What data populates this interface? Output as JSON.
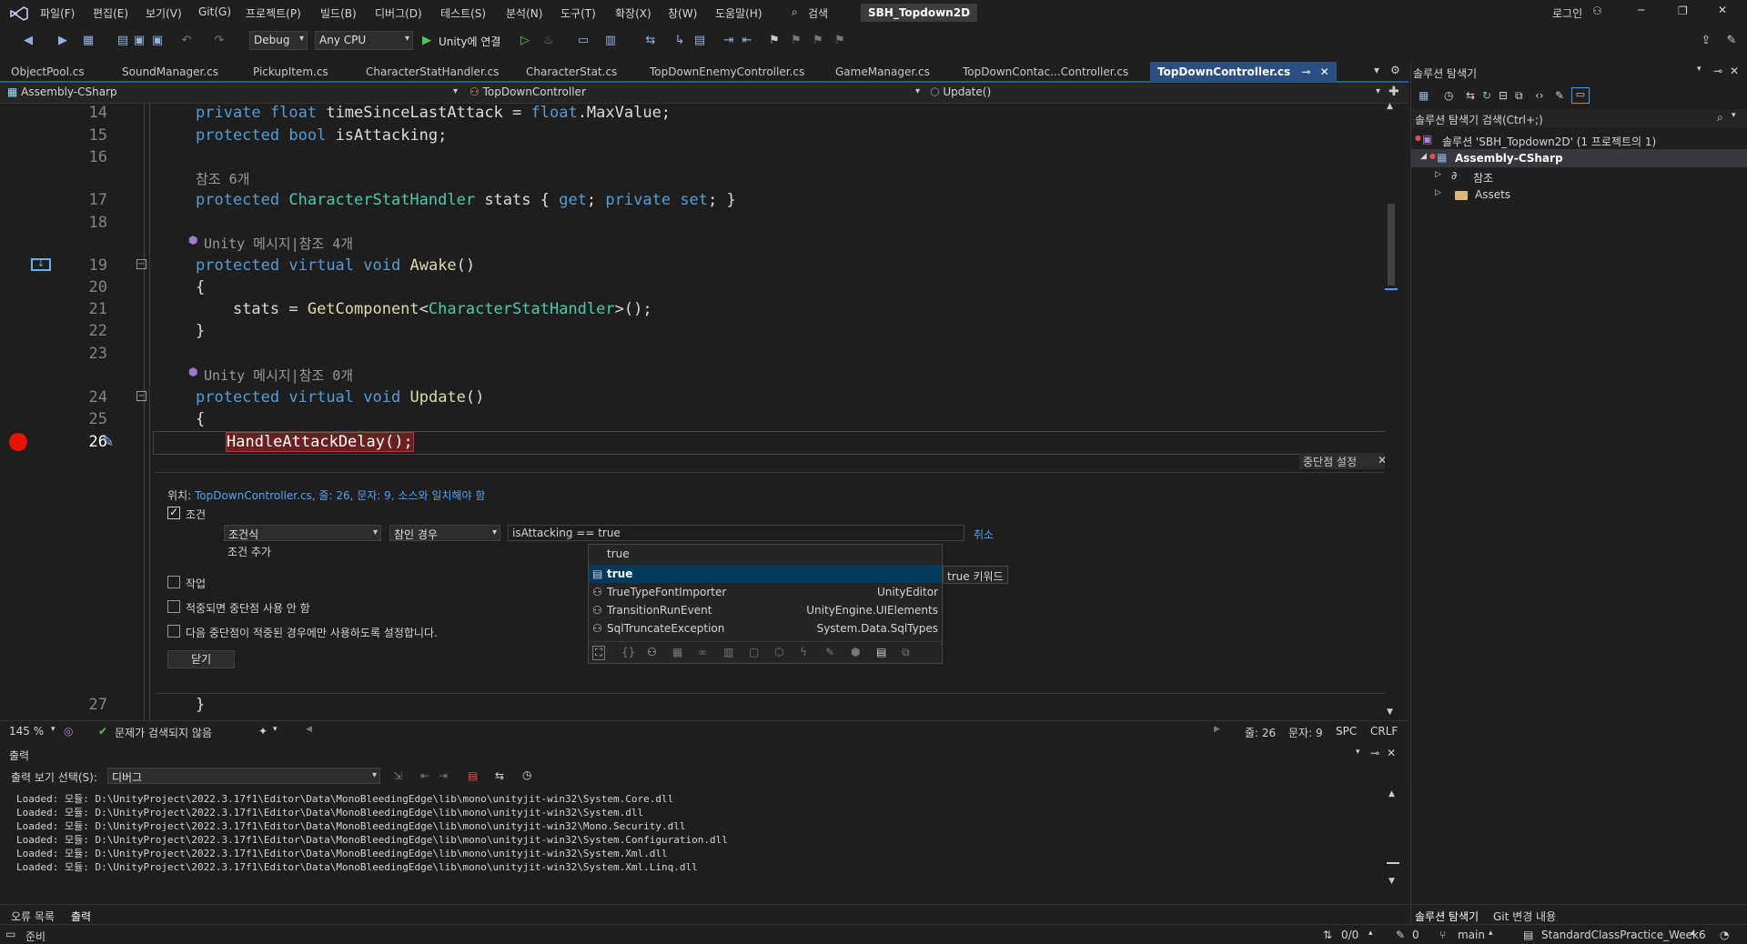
{
  "menu": [
    "파일(F)",
    "편집(E)",
    "보기(V)",
    "Git(G)",
    "프로젝트(P)",
    "빌드(B)",
    "디버그(D)",
    "테스트(S)",
    "분석(N)",
    "도구(T)",
    "확장(X)",
    "창(W)",
    "도움말(H)"
  ],
  "search_label": "검색",
  "solution_badge": "SBH_Topdown2D",
  "login_label": "로그인",
  "toolbar": {
    "config": "Debug",
    "platform": "Any CPU",
    "run_label": "Unity에 연결"
  },
  "tabs": [
    "ObjectPool.cs",
    "SoundManager.cs",
    "PickupItem.cs",
    "CharacterStatHandler.cs",
    "CharacterStat.cs",
    "TopDownEnemyController.cs",
    "GameManager.cs",
    "TopDownContac...Controller.cs",
    "TopDownController.cs"
  ],
  "navbar": {
    "project": "Assembly-CSharp",
    "class": "TopDownController",
    "member": "Update()"
  },
  "code": {
    "lines": {
      "l14": "14",
      "l15": "15",
      "l16": "16",
      "l17": "17",
      "l18": "18",
      "l19": "19",
      "l20": "20",
      "l21": "21",
      "l22": "22",
      "l23": "23",
      "l24": "24",
      "l25": "25",
      "l26": "26",
      "l27": "27"
    },
    "t14a": "private",
    "t14b": "float",
    "t14c": " timeSinceLastAttack = ",
    "t14d": "float",
    "t14e": ".MaxValue;",
    "t15a": "protected",
    "t15b": "bool",
    "t15c": " isAttacking;",
    "lens17": "참조 6개",
    "t17a": "protected",
    "t17b": "CharacterStatHandler",
    "t17c": " stats { ",
    "t17d": "get",
    "t17e": "; ",
    "t17f": "private",
    "t17g": "set",
    "t17h": "; }",
    "lens19": "Unity 메시지|참조 4개",
    "t19a": "protected",
    "t19b": "virtual",
    "t19c": "void",
    "t19d": "Awake",
    "t20": "{",
    "t21a": "    stats = ",
    "t21b": "GetComponent",
    "t21c": "<",
    "t21d": "CharacterStatHandler",
    "t21e": ">();",
    "t22": "}",
    "lens24": "Unity 메시지|참조 0개",
    "t24a": "protected",
    "t24b": "virtual",
    "t24c": "void",
    "t24d": "Update",
    "t25": "{",
    "t26": "HandleAttackDelay();",
    "t27": "}"
  },
  "breakpoint_settings": {
    "title": "중단점 설정",
    "location_label": "위치: ",
    "location_link": "TopDownController.cs, 줄: 26, 문자: 9, 소스와 일치해야 함",
    "condition_label": "조건",
    "condition_type": "조건식",
    "condition_when": "참인 경우",
    "condition_expr": "isAttacking == true",
    "cancel": "취소",
    "add_condition": "조건 추가",
    "action_label": "작업",
    "disable_once_hit": "적중되면 중단점 사용 안 함",
    "only_when_hit": "다음 중단점이 적중된 경우에만 사용하도록 설정합니다.",
    "close": "닫기"
  },
  "autocomplete": {
    "header": "true",
    "items": [
      {
        "name": "true",
        "ns": ""
      },
      {
        "name": "TrueTypeFontImporter",
        "ns": "UnityEditor"
      },
      {
        "name": "TransitionRunEvent",
        "ns": "UnityEngine.UIElements"
      },
      {
        "name": "SqlTruncateException",
        "ns": "System.Data.SqlTypes"
      }
    ],
    "tooltip": "true 키워드"
  },
  "editor_status": {
    "zoom": "145 %",
    "issues": "문제가 검색되지 않음",
    "line": "줄: 26",
    "char": "문자: 9",
    "spc": "SPC",
    "crlf": "CRLF"
  },
  "output": {
    "title": "출력",
    "source_label": "출력 보기 선택(S):",
    "source_value": "디버그",
    "lines": [
      "Loaded: 모듈: D:\\UnityProject\\2022.3.17f1\\Editor\\Data\\MonoBleedingEdge\\lib\\mono\\unityjit-win32\\System.Core.dll",
      "Loaded: 모듈: D:\\UnityProject\\2022.3.17f1\\Editor\\Data\\MonoBleedingEdge\\lib\\mono\\unityjit-win32\\System.dll",
      "Loaded: 모듈: D:\\UnityProject\\2022.3.17f1\\Editor\\Data\\MonoBleedingEdge\\lib\\mono\\unityjit-win32\\Mono.Security.dll",
      "Loaded: 모듈: D:\\UnityProject\\2022.3.17f1\\Editor\\Data\\MonoBleedingEdge\\lib\\mono\\unityjit-win32\\System.Configuration.dll",
      "Loaded: 모듈: D:\\UnityProject\\2022.3.17f1\\Editor\\Data\\MonoBleedingEdge\\lib\\mono\\unityjit-win32\\System.Xml.dll",
      "Loaded: 모듈: D:\\UnityProject\\2022.3.17f1\\Editor\\Data\\MonoBleedingEdge\\lib\\mono\\unityjit-win32\\System.Xml.Linq.dll"
    ],
    "bottom_tabs": [
      "오류 목록",
      "출력"
    ]
  },
  "solution": {
    "title": "솔루션 탐색기",
    "search": "솔루션 탐색기 검색(Ctrl+;)",
    "root": "솔루션 'SBH_Topdown2D' (1 프로젝트의 1)",
    "project": "Assembly-CSharp",
    "refs": "참조",
    "assets": "Assets",
    "bottom_tabs": [
      "솔루션 탐색기",
      "Git 변경 내용"
    ]
  },
  "statusbar": {
    "ready": "준비",
    "updown": "0/0",
    "pencil": "0",
    "branch": "main",
    "repo": "StandardClassPractice_Week6"
  }
}
